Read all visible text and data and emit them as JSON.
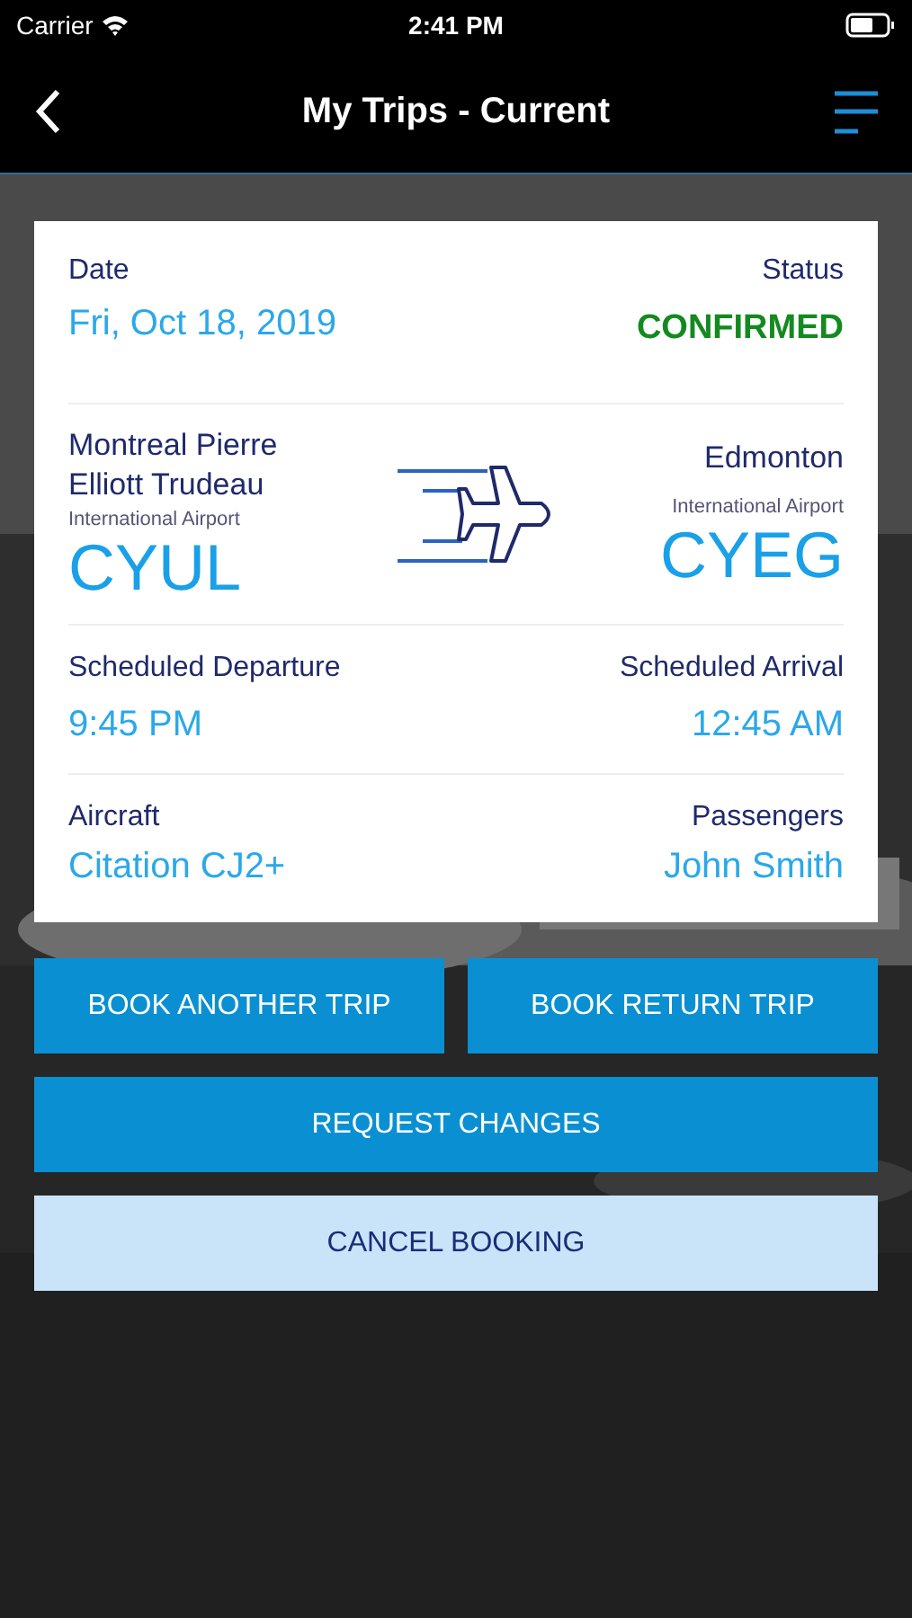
{
  "status_bar": {
    "carrier": "Carrier",
    "time": "2:41 PM"
  },
  "nav": {
    "title": "My Trips - Current"
  },
  "trip": {
    "date_label": "Date",
    "date": "Fri, Oct 18, 2019",
    "status_label": "Status",
    "status": "CONFIRMED",
    "origin": {
      "name": "Montreal Pierre Elliott Trudeau",
      "subtitle": "International Airport",
      "code": "CYUL"
    },
    "destination": {
      "name": "Edmonton",
      "subtitle": "International Airport",
      "code": "CYEG"
    },
    "departure_label": "Scheduled Departure",
    "departure": "9:45 PM",
    "arrival_label": "Scheduled Arrival",
    "arrival": "12:45 AM",
    "aircraft_label": "Aircraft",
    "aircraft": "Citation CJ2+",
    "passengers_label": "Passengers",
    "passengers": "John Smith"
  },
  "button_rows": [
    [
      {
        "label": "BOOK ANOTHER TRIP",
        "kind": "primary"
      },
      {
        "label": "BOOK RETURN TRIP",
        "kind": "primary"
      }
    ],
    [
      {
        "label": "REQUEST CHANGES",
        "kind": "primary"
      }
    ],
    [
      {
        "label": "CANCEL BOOKING",
        "kind": "secondary"
      }
    ]
  ]
}
